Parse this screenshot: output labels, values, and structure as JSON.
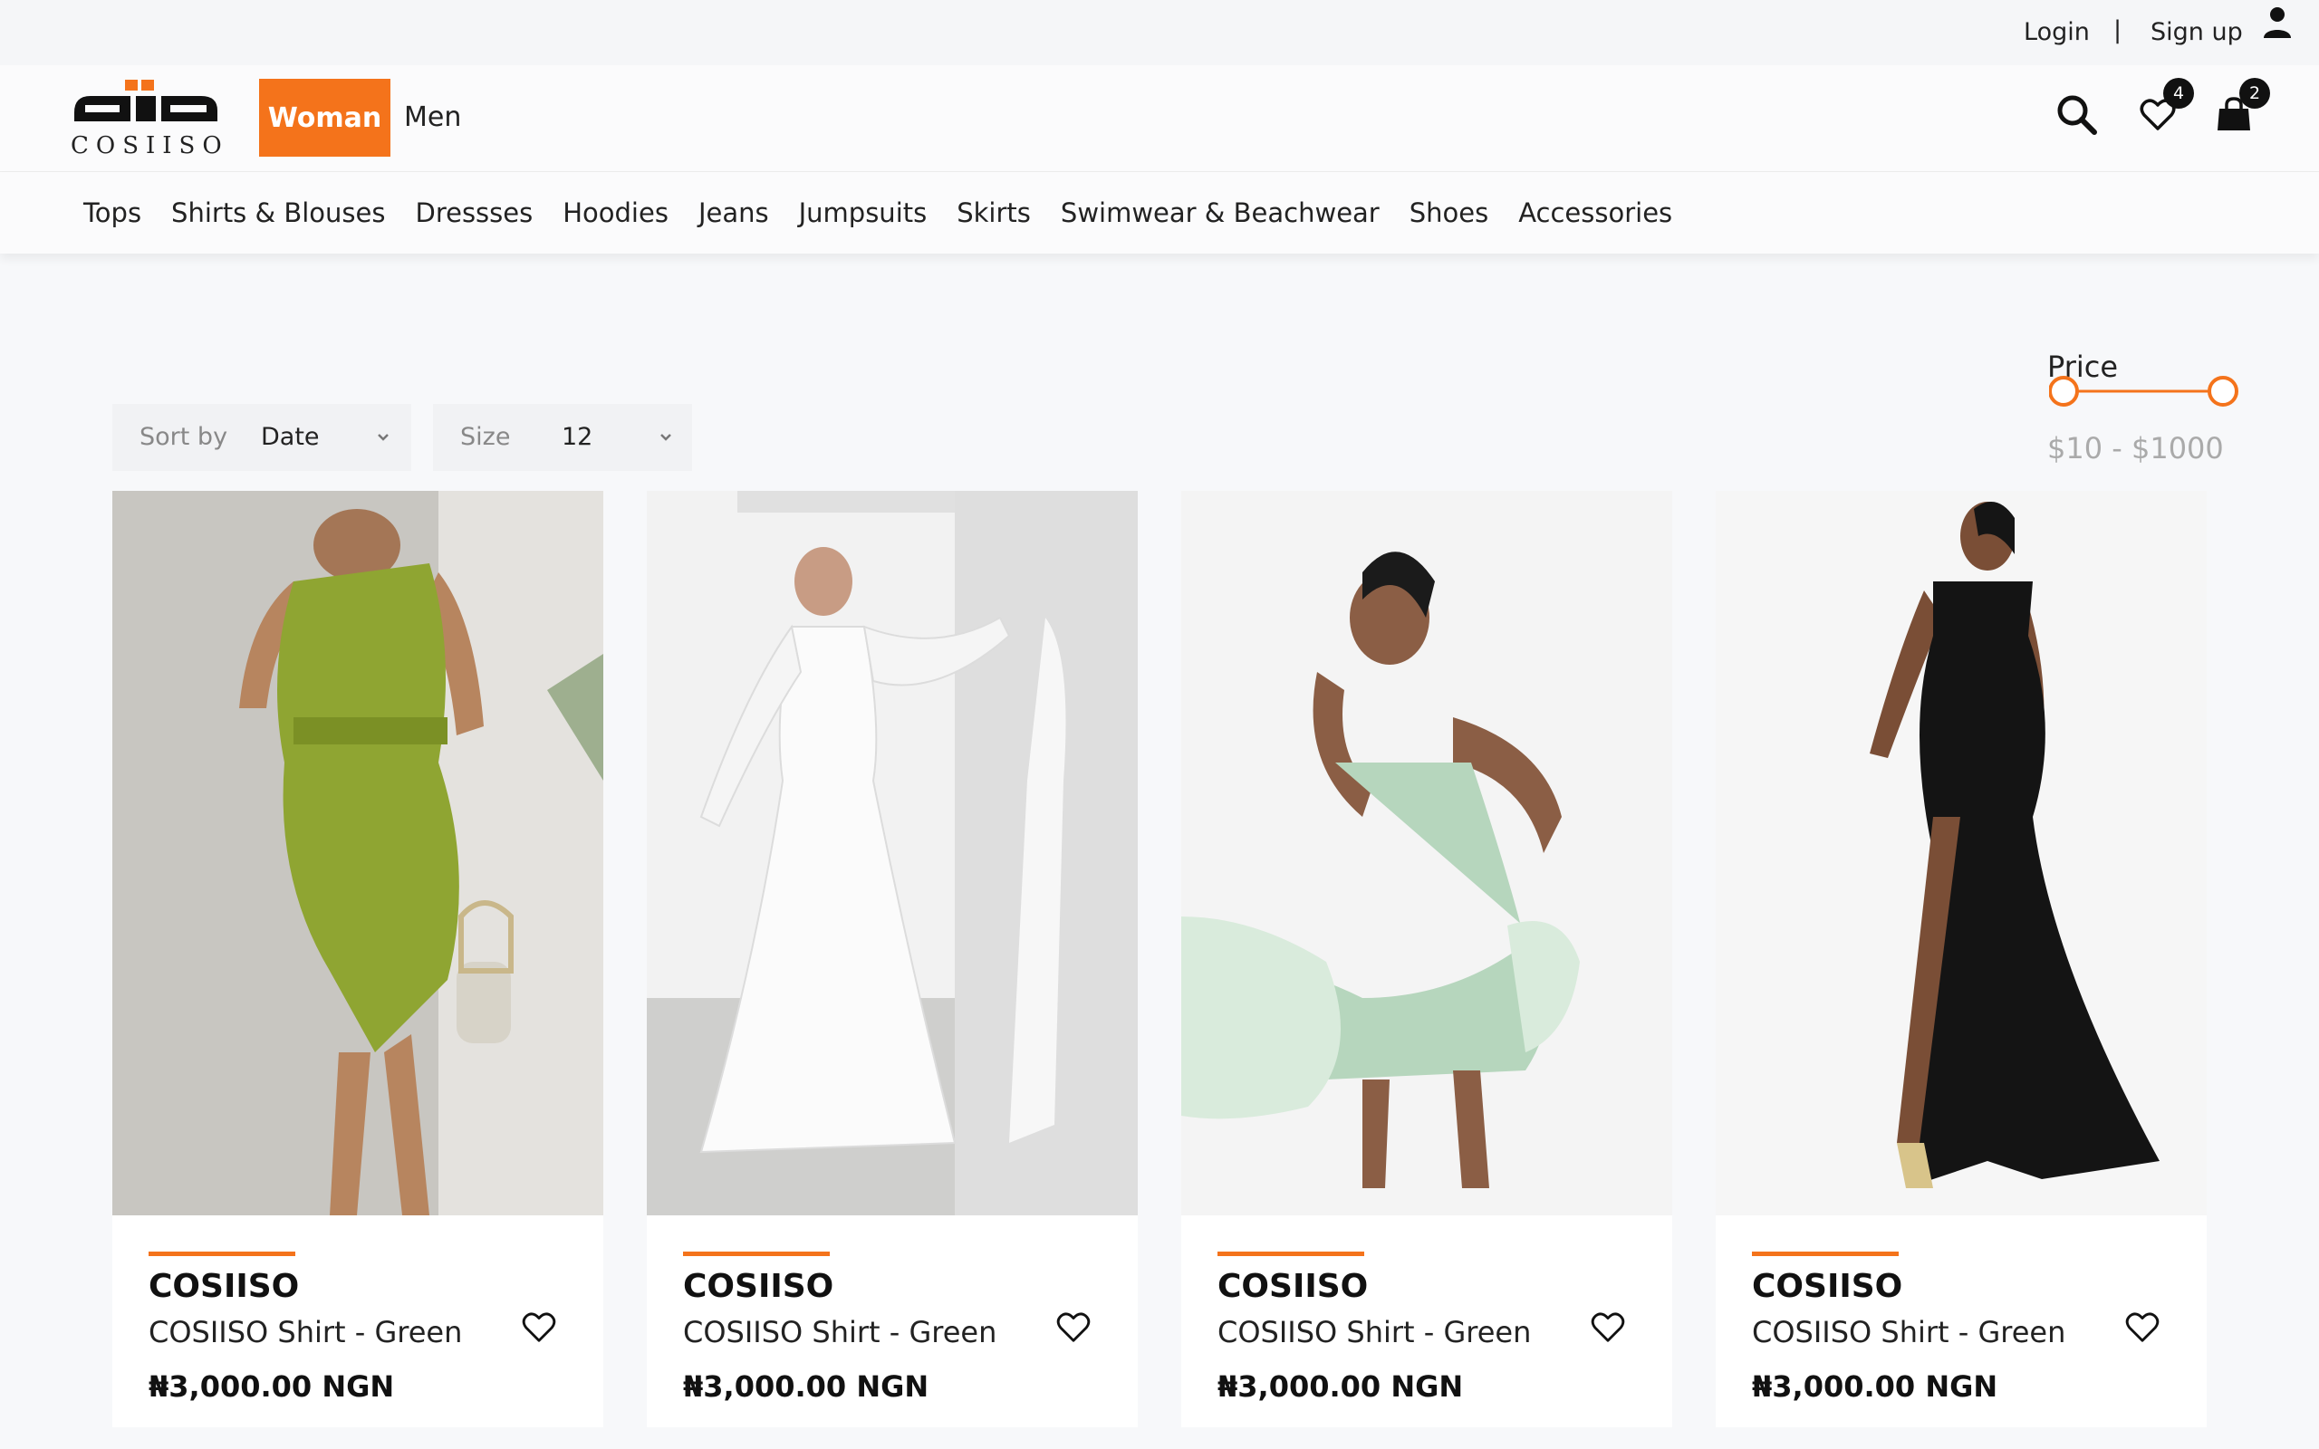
{
  "topbar": {
    "login": "Login",
    "separator": "|",
    "signup": "Sign up",
    "user_icon": "user-icon"
  },
  "header": {
    "logo_text": "COSIISO",
    "tabs": [
      {
        "label": "Woman",
        "active": true
      },
      {
        "label": "Men",
        "active": false
      }
    ],
    "wishlist_count": "4",
    "cart_count": "2",
    "accent_color": "#f4731b"
  },
  "categories": [
    "Tops",
    "Shirts & Blouses",
    "Dressses",
    "Hoodies",
    "Jeans",
    "Jumpsuits",
    "Skirts",
    "Swimwear & Beachwear",
    "Shoes",
    "Accessories"
  ],
  "controls": {
    "sort": {
      "label": "Sort by",
      "value": "Date"
    },
    "size": {
      "label": "Size",
      "value": "12"
    }
  },
  "price_filter": {
    "title": "Price",
    "range": "$10 - $1000",
    "min": 10,
    "max": 1000
  },
  "products": [
    {
      "brand": "COSIISO",
      "name": "COSIISO Shirt - Green",
      "price": "₦3,000.00 NGN",
      "image": "olive green one-shoulder pleated wrap dress"
    },
    {
      "brand": "COSIISO",
      "name": "COSIISO Shirt - Green",
      "price": "₦3,000.00 NGN",
      "image": "white embellished gown with long sleeves"
    },
    {
      "brand": "COSIISO",
      "name": "COSIISO Shirt - Green",
      "price": "₦3,000.00 NGN",
      "image": "mint green embellished feather-hem dress"
    },
    {
      "brand": "COSIISO",
      "name": "COSIISO Shirt - Green",
      "price": "₦3,000.00 NGN",
      "image": "black strapless gown with thigh slit"
    }
  ]
}
